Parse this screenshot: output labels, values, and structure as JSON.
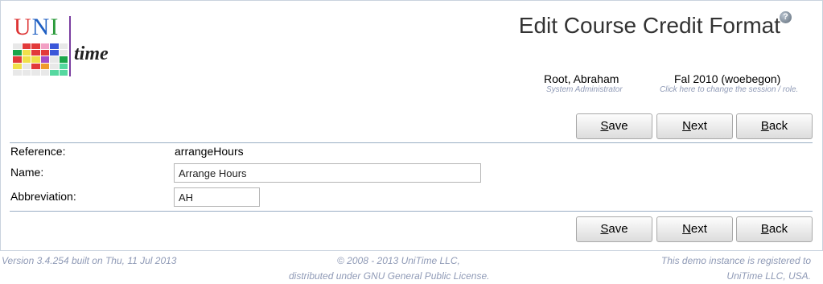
{
  "header": {
    "title": "Edit Course Credit Format",
    "help_icon": "?",
    "logo": {
      "uni": [
        "U",
        "N",
        "I"
      ],
      "time": "time"
    }
  },
  "user": {
    "name": "Root, Abraham",
    "role": "System Administrator"
  },
  "session": {
    "name": "Fal 2010 (woebegon)",
    "hint": "Click here to change the session / role."
  },
  "buttons": {
    "save": {
      "key": "S",
      "rest": "ave"
    },
    "next": {
      "key": "N",
      "rest": "ext"
    },
    "back": {
      "key": "B",
      "rest": "ack"
    }
  },
  "form": {
    "reference": {
      "label": "Reference:",
      "value": "arrangeHours"
    },
    "name": {
      "label": "Name:",
      "value": "Arrange Hours"
    },
    "abbreviation": {
      "label": "Abbreviation:",
      "value": "AH"
    }
  },
  "footer": {
    "version": "Version 3.4.254 built on Thu, 11 Jul 2013",
    "copyright_line1": "© 2008 - 2013 UniTime LLC,",
    "copyright_line2": "distributed under GNU General Public License.",
    "registered_line1": "This demo instance is registered to",
    "registered_line2": "UniTime LLC, USA."
  },
  "colors": {
    "accent": "#8f9ab6",
    "rule": "#9aaec4",
    "logo_bar": "#7b3fa0"
  }
}
